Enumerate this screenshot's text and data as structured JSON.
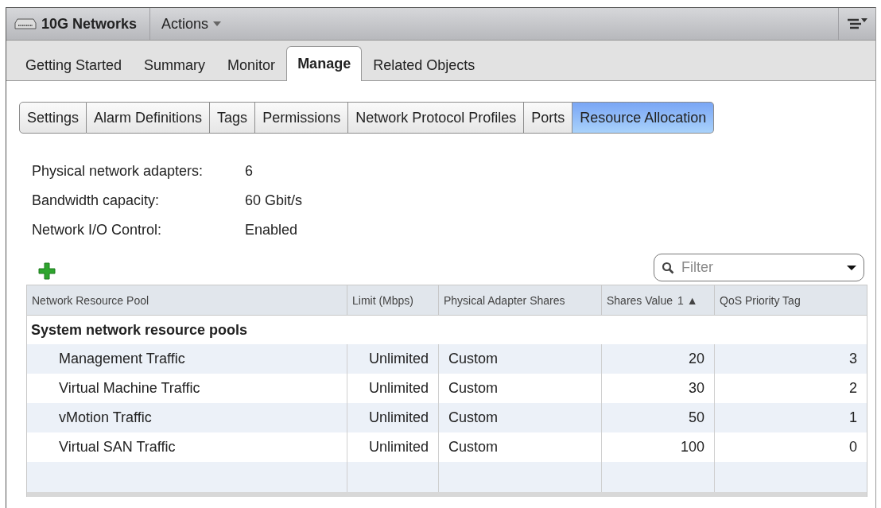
{
  "header": {
    "title": "10G Networks",
    "actions": "Actions"
  },
  "tabs": [
    {
      "label": "Getting Started",
      "selected": false
    },
    {
      "label": "Summary",
      "selected": false
    },
    {
      "label": "Monitor",
      "selected": false
    },
    {
      "label": "Manage",
      "selected": true
    },
    {
      "label": "Related Objects",
      "selected": false
    }
  ],
  "subtabs": [
    {
      "label": "Settings",
      "selected": false
    },
    {
      "label": "Alarm Definitions",
      "selected": false
    },
    {
      "label": "Tags",
      "selected": false
    },
    {
      "label": "Permissions",
      "selected": false
    },
    {
      "label": "Network Protocol Profiles",
      "selected": false
    },
    {
      "label": "Ports",
      "selected": false
    },
    {
      "label": "Resource Allocation",
      "selected": true
    }
  ],
  "info": [
    {
      "label": "Physical network adapters:",
      "value": "6"
    },
    {
      "label": "Bandwidth capacity:",
      "value": "60 Gbit/s"
    },
    {
      "label": "Network I/O Control:",
      "value": "Enabled"
    }
  ],
  "filter": {
    "placeholder": "Filter"
  },
  "table": {
    "columns": [
      {
        "label": "Network Resource Pool"
      },
      {
        "label": "Limit (Mbps)"
      },
      {
        "label": "Physical Adapter Shares"
      },
      {
        "label": "Shares Value",
        "sort": "1 ▲"
      },
      {
        "label": "QoS Priority Tag"
      }
    ],
    "group": "System network resource pools",
    "rows": [
      [
        "Management Traffic",
        "Unlimited",
        "Custom",
        "20",
        "3"
      ],
      [
        "Virtual Machine Traffic",
        "Unlimited",
        "Custom",
        "30",
        "2"
      ],
      [
        "vMotion Traffic",
        "Unlimited",
        "Custom",
        "50",
        "1"
      ],
      [
        "Virtual SAN Traffic",
        "Unlimited",
        "Custom",
        "100",
        "0"
      ]
    ]
  }
}
